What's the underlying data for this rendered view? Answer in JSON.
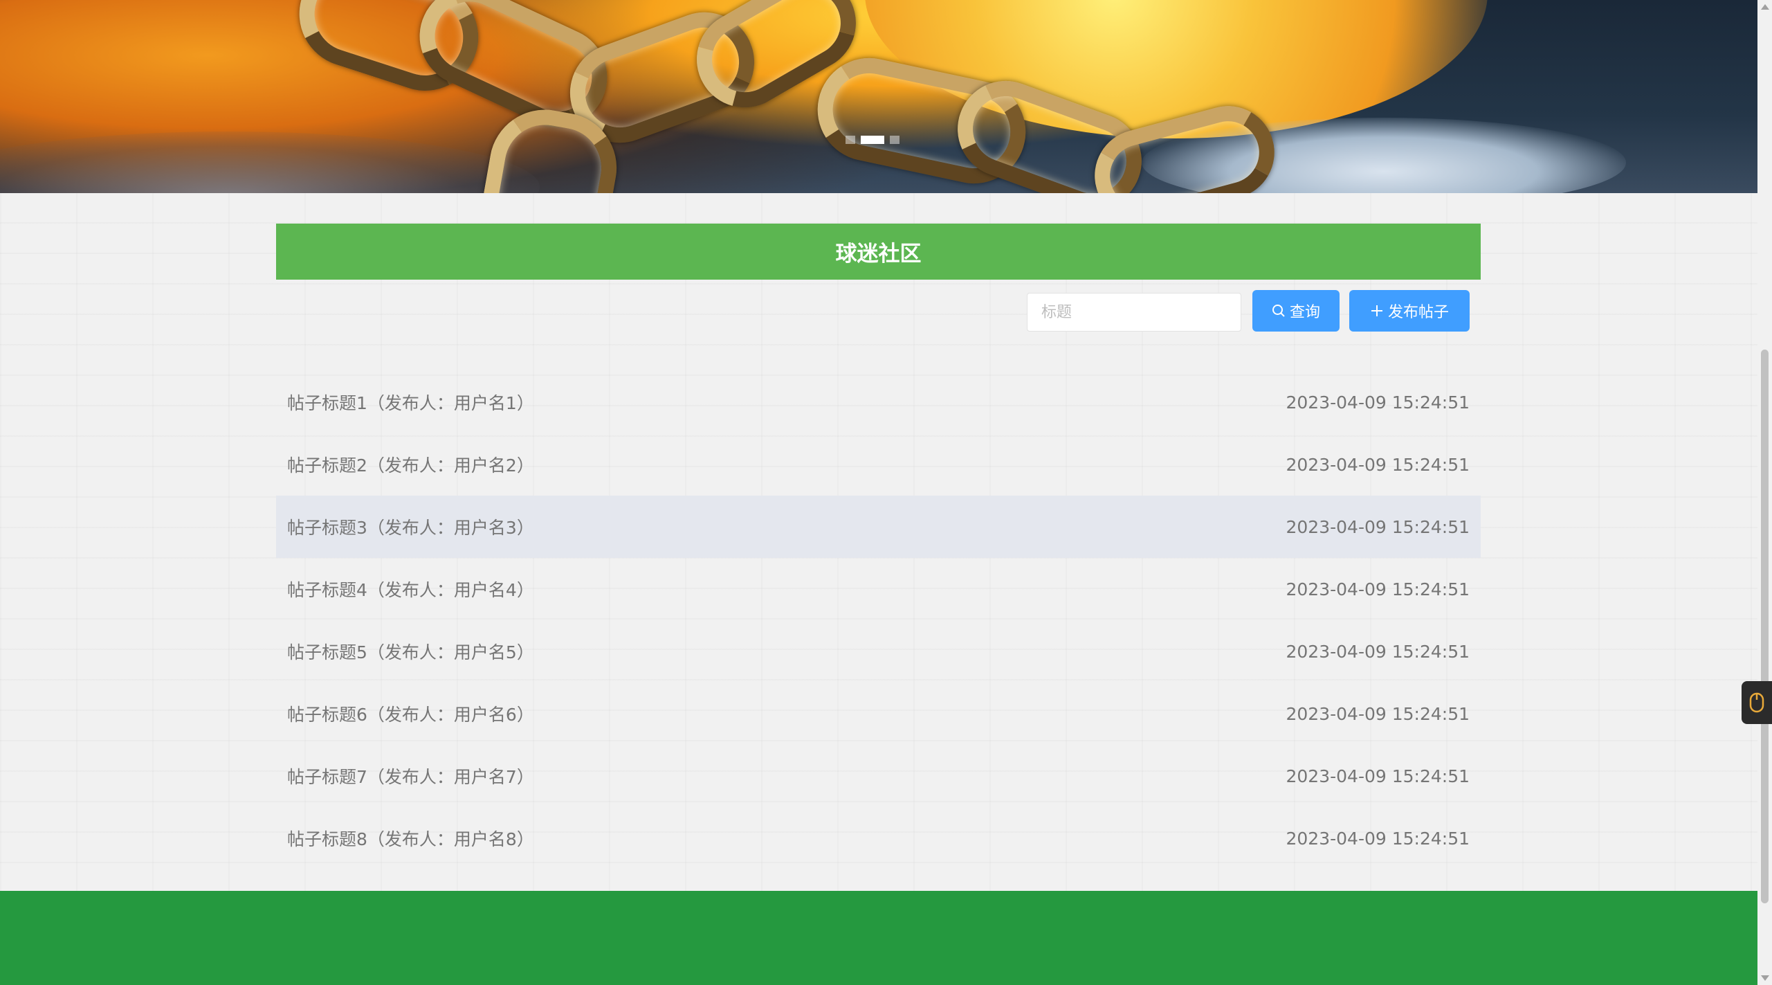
{
  "banner": {
    "carousel_indicators": 3,
    "active_index": 1
  },
  "section": {
    "title": "球迷社区"
  },
  "search": {
    "placeholder": "标题",
    "value": "",
    "search_button": "查询",
    "post_button": "发布帖子"
  },
  "posts": [
    {
      "title": "帖子标题1（发布人：用户名1）",
      "time": "2023-04-09 15:24:51"
    },
    {
      "title": "帖子标题2（发布人：用户名2）",
      "time": "2023-04-09 15:24:51"
    },
    {
      "title": "帖子标题3（发布人：用户名3）",
      "time": "2023-04-09 15:24:51"
    },
    {
      "title": "帖子标题4（发布人：用户名4）",
      "time": "2023-04-09 15:24:51"
    },
    {
      "title": "帖子标题5（发布人：用户名5）",
      "time": "2023-04-09 15:24:51"
    },
    {
      "title": "帖子标题6（发布人：用户名6）",
      "time": "2023-04-09 15:24:51"
    },
    {
      "title": "帖子标题7（发布人：用户名7）",
      "time": "2023-04-09 15:24:51"
    },
    {
      "title": "帖子标题8（发布人：用户名8）",
      "time": "2023-04-09 15:24:51"
    }
  ],
  "colors": {
    "header_green": "#5cb651",
    "footer_green": "#25993f",
    "button_blue": "#409eff",
    "row_hover": "#e4e7ee",
    "text_gray": "#757575"
  },
  "icons": {
    "search_button_icon": "search-icon",
    "post_button_icon": "plus-icon",
    "side_tool_icon": "mouse-icon"
  }
}
